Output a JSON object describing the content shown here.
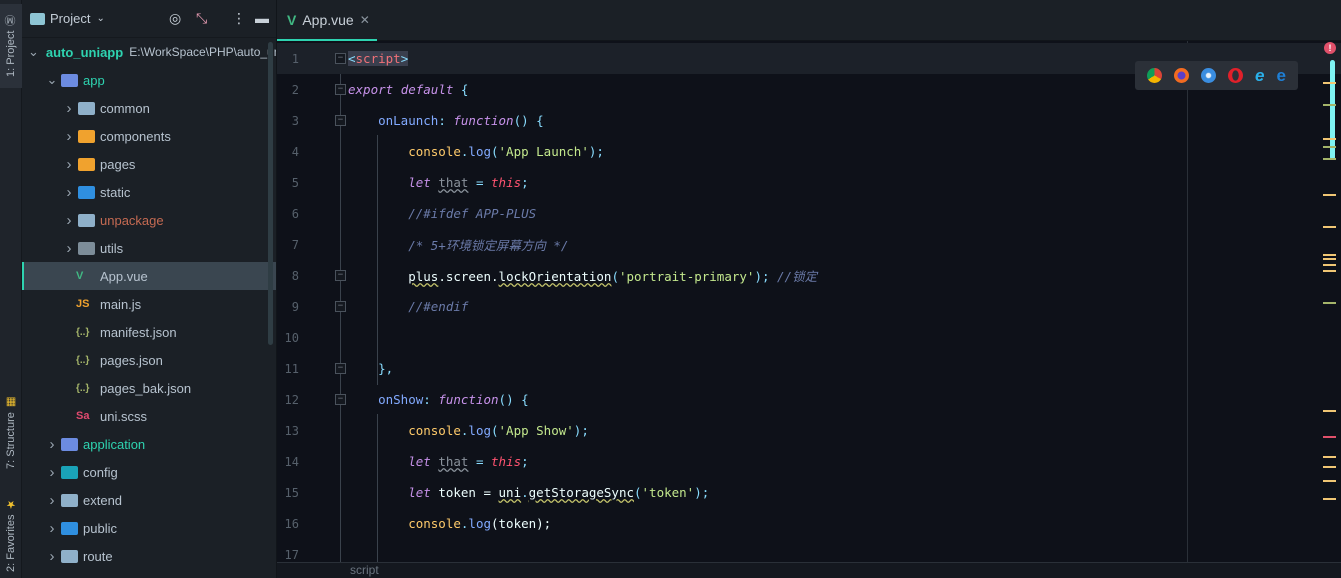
{
  "stripe": {
    "project": "1: Project",
    "structure": "7: Structure",
    "favorites": "2: Favorites"
  },
  "project_panel": {
    "title": "Project",
    "icons": [
      "target-icon",
      "collapse-icon",
      "more-icon",
      "minimize-icon"
    ],
    "tree": [
      {
        "label": "auto_uniapp",
        "path": "E:\\WorkSpace\\PHP\\auto_uniapp",
        "level": 0,
        "expanded": true,
        "color": "#2ed3b0",
        "icon": "#b07fd6",
        "bold": true
      },
      {
        "label": "app",
        "level": 1,
        "expanded": true,
        "color": "#2ed3b0",
        "icon": "#6c8be0"
      },
      {
        "label": "common",
        "level": 2,
        "expanded": false,
        "color": "#b7c3cf",
        "icon": "#8fb0c9"
      },
      {
        "label": "components",
        "level": 2,
        "expanded": false,
        "color": "#b7c3cf",
        "icon": "#f0a22e"
      },
      {
        "label": "pages",
        "level": 2,
        "expanded": false,
        "color": "#b7c3cf",
        "icon": "#f0a22e"
      },
      {
        "label": "static",
        "level": 2,
        "expanded": false,
        "color": "#b7c3cf",
        "icon": "#2f8fe0"
      },
      {
        "label": "unpackage",
        "level": 2,
        "expanded": false,
        "color": "#c46a52",
        "icon": "#8fb0c9"
      },
      {
        "label": "utils",
        "level": 2,
        "expanded": false,
        "color": "#b7c3cf",
        "icon": "#7d8d99"
      },
      {
        "label": "App.vue",
        "level": 2,
        "file": true,
        "selected": true,
        "color": "#b7c3cf",
        "glyph": "V",
        "glyphColor": "#41b883"
      },
      {
        "label": "main.js",
        "level": 2,
        "file": true,
        "color": "#b7c3cf",
        "glyph": "JS",
        "glyphColor": "#f0a22e"
      },
      {
        "label": "manifest.json",
        "level": 2,
        "file": true,
        "color": "#b7c3cf",
        "glyph": "{..}",
        "glyphColor": "#a5b56a"
      },
      {
        "label": "pages.json",
        "level": 2,
        "file": true,
        "color": "#b7c3cf",
        "glyph": "{..}",
        "glyphColor": "#a5b56a"
      },
      {
        "label": "pages_bak.json",
        "level": 2,
        "file": true,
        "color": "#b7c3cf",
        "glyph": "{..}",
        "glyphColor": "#a5b56a"
      },
      {
        "label": "uni.scss",
        "level": 2,
        "file": true,
        "color": "#b7c3cf",
        "glyph": "Sa",
        "glyphColor": "#e04a6f"
      },
      {
        "label": "application",
        "level": 1,
        "expanded": false,
        "color": "#2ed3b0",
        "icon": "#6c8be0"
      },
      {
        "label": "config",
        "level": 1,
        "expanded": false,
        "color": "#b7c3cf",
        "icon": "#1aa3b8"
      },
      {
        "label": "extend",
        "level": 1,
        "expanded": false,
        "color": "#b7c3cf",
        "icon": "#8fb0c9"
      },
      {
        "label": "public",
        "level": 1,
        "expanded": false,
        "color": "#b7c3cf",
        "icon": "#2f8fe0"
      },
      {
        "label": "route",
        "level": 1,
        "expanded": false,
        "color": "#b7c3cf",
        "icon": "#8fb0c9"
      }
    ]
  },
  "editor": {
    "tab": "App.vue",
    "breadcrumb": "script",
    "browsers": [
      "chrome-icon",
      "firefox-icon",
      "safari-icon",
      "opera-icon",
      "ie-icon",
      "edge-icon"
    ],
    "lines": [
      [
        [
          "<",
          "tagb"
        ],
        [
          "script",
          "tag"
        ],
        [
          ">",
          "tagb"
        ]
      ],
      [
        [
          "export",
          "kw"
        ],
        [
          " ",
          "plain"
        ],
        [
          "default",
          "kw"
        ],
        [
          " {",
          "punc"
        ]
      ],
      [
        [
          "    onLaunch",
          "prop"
        ],
        [
          ": ",
          "punc"
        ],
        [
          "function",
          "kw"
        ],
        [
          "() {",
          "punc"
        ]
      ],
      [
        [
          "        console",
          "obj"
        ],
        [
          ".",
          "punc"
        ],
        [
          "log",
          "fn"
        ],
        [
          "(",
          "punc"
        ],
        [
          "'App Launch'",
          "str"
        ],
        [
          ");",
          "punc"
        ]
      ],
      [
        [
          "        let",
          "kw"
        ],
        [
          " ",
          "plain"
        ],
        [
          "that",
          "var"
        ],
        [
          " = ",
          "punc"
        ],
        [
          "this",
          "this"
        ],
        [
          ";",
          "punc"
        ]
      ],
      [
        [
          "        //#ifdef APP-PLUS",
          "cm"
        ]
      ],
      [
        [
          "        /* 5+环境锁定屏幕方向 */",
          "cm"
        ]
      ],
      [
        [
          "        ",
          "plain"
        ],
        [
          "plus",
          "plain warn"
        ],
        [
          ".screen.",
          "plain"
        ],
        [
          "lockOrientation",
          "plain warn"
        ],
        [
          "(",
          "punc"
        ],
        [
          "'portrait-primary'",
          "str"
        ],
        [
          "); ",
          "punc"
        ],
        [
          "//锁定",
          "cm"
        ]
      ],
      [
        [
          "        //#endif",
          "cm"
        ]
      ],
      [],
      [
        [
          "    },",
          "punc"
        ]
      ],
      [
        [
          "    onShow",
          "prop"
        ],
        [
          ": ",
          "punc"
        ],
        [
          "function",
          "kw"
        ],
        [
          "() {",
          "punc"
        ]
      ],
      [
        [
          "        console",
          "obj"
        ],
        [
          ".",
          "punc"
        ],
        [
          "log",
          "fn"
        ],
        [
          "(",
          "punc"
        ],
        [
          "'App Show'",
          "str"
        ],
        [
          ");",
          "punc"
        ]
      ],
      [
        [
          "        let",
          "kw"
        ],
        [
          " ",
          "plain"
        ],
        [
          "that",
          "var"
        ],
        [
          " = ",
          "punc"
        ],
        [
          "this",
          "this"
        ],
        [
          ";",
          "punc"
        ]
      ],
      [
        [
          "        let",
          "kw"
        ],
        [
          " token = ",
          "plain"
        ],
        [
          "uni",
          "plain warn"
        ],
        [
          ".",
          "punc"
        ],
        [
          "getStorageSync",
          "plain warn"
        ],
        [
          "(",
          "punc"
        ],
        [
          "'token'",
          "str"
        ],
        [
          ");",
          "punc"
        ]
      ],
      [
        [
          "        console",
          "obj"
        ],
        [
          ".",
          "punc"
        ],
        [
          "log",
          "fn"
        ],
        [
          "(token);",
          "plain"
        ]
      ],
      []
    ]
  }
}
